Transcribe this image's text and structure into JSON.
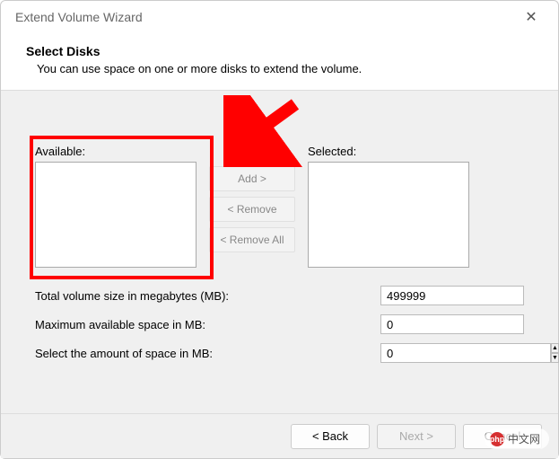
{
  "window": {
    "title": "Extend Volume Wizard"
  },
  "header": {
    "title": "Select Disks",
    "subtitle": "You can use space on one or more disks to extend the volume."
  },
  "labels": {
    "available": "Available:",
    "selected": "Selected:"
  },
  "buttons": {
    "add": "Add >",
    "remove": "< Remove",
    "remove_all": "< Remove All",
    "back": "< Back",
    "next": "Next >",
    "cancel": "Cancel"
  },
  "rows": {
    "total_label": "Total volume size in megabytes (MB):",
    "total_value": "499999",
    "max_label": "Maximum available space in MB:",
    "max_value": "0",
    "select_label": "Select the amount of space in MB:",
    "select_value": "0"
  },
  "watermark": {
    "text": "中文网",
    "logo": "php"
  }
}
